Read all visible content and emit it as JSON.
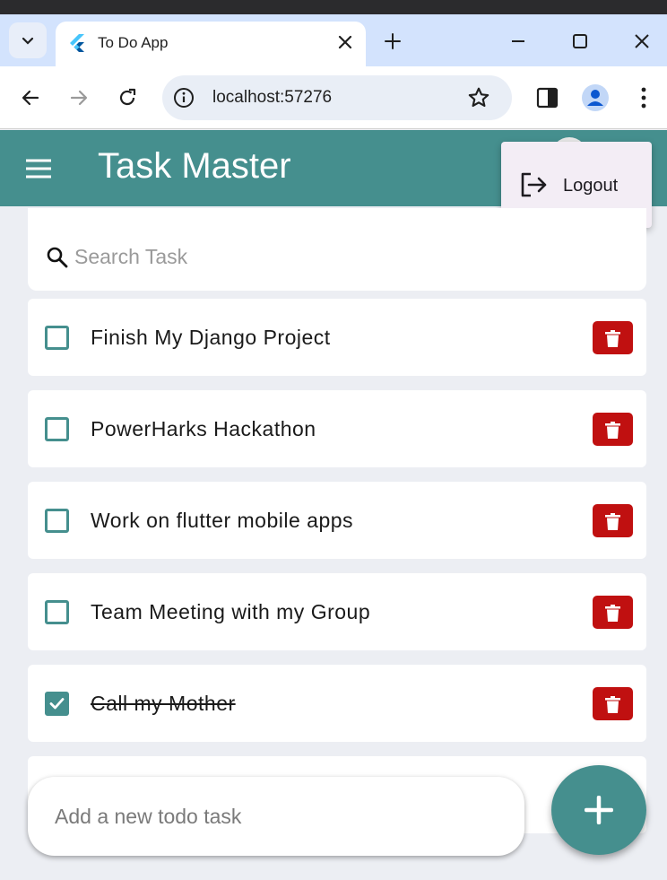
{
  "browser": {
    "tab_title": "To Do App",
    "url": "localhost:57276"
  },
  "app": {
    "title": "Task Master",
    "menu": {
      "logout_label": "Logout"
    },
    "search": {
      "placeholder": "Search Task"
    },
    "tasks": [
      {
        "text": "Finish My Django Project",
        "done": false
      },
      {
        "text": "PowerHarks Hackathon",
        "done": false
      },
      {
        "text": "Work on flutter mobile apps",
        "done": false
      },
      {
        "text": "Team Meeting with my Group",
        "done": false
      },
      {
        "text": "Call my Mother",
        "done": true
      }
    ],
    "add_task": {
      "placeholder": "Add a new todo task"
    }
  },
  "colors": {
    "accent": "#458f8e",
    "delete": "#c01010",
    "tab_strip": "#d3e3fd"
  }
}
